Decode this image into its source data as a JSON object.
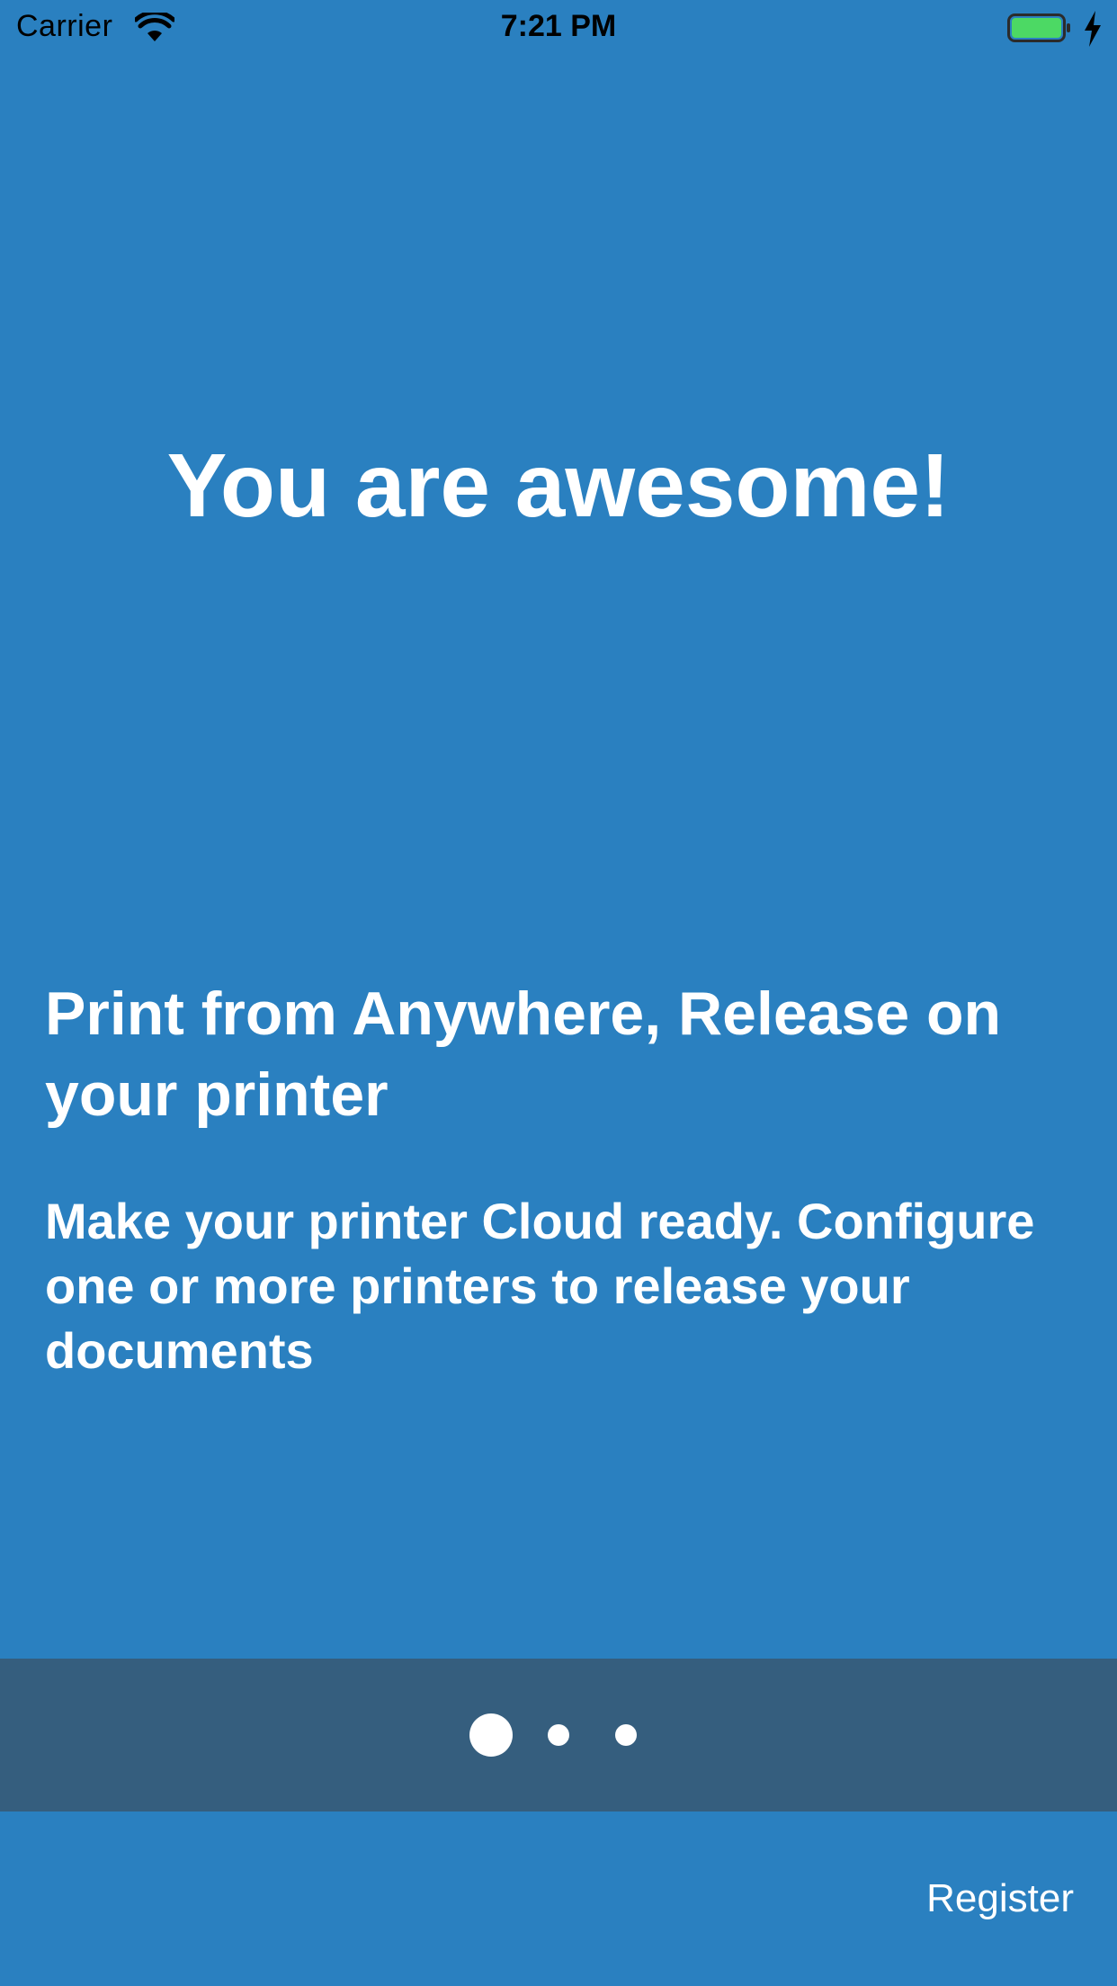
{
  "status_bar": {
    "carrier": "Carrier",
    "time": "7:21 PM",
    "wifi_icon": "wifi-icon",
    "battery_icon": "battery-charging-icon",
    "battery_level": 1.0,
    "battery_color": "#4cd964"
  },
  "onboarding": {
    "hero_title": "You are awesome!",
    "headline": "Print from Anywhere, Release on your printer",
    "body": "Make your printer Cloud ready. Configure one or more printers to release your documents"
  },
  "pager": {
    "page_count": 3,
    "current_page": 1
  },
  "footer": {
    "register_label": "Register"
  },
  "colors": {
    "background": "#2a80c0",
    "pager_band": "#355e7e",
    "text": "#ffffff"
  }
}
